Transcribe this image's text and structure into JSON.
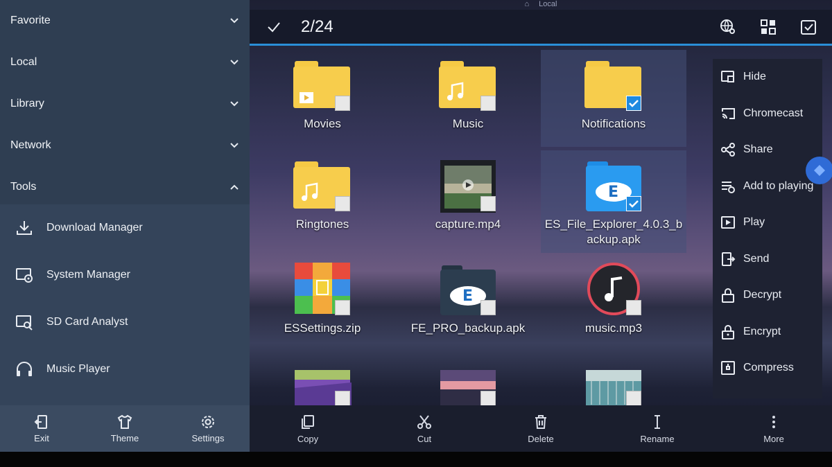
{
  "sidebar": {
    "categories": [
      {
        "label": "Favorite",
        "expanded": false
      },
      {
        "label": "Local",
        "expanded": false
      },
      {
        "label": "Library",
        "expanded": false
      },
      {
        "label": "Network",
        "expanded": false
      },
      {
        "label": "Tools",
        "expanded": true
      }
    ],
    "tools": [
      {
        "label": "Download Manager",
        "icon": "download-icon"
      },
      {
        "label": "System Manager",
        "icon": "system-manager-icon"
      },
      {
        "label": "SD Card Analyst",
        "icon": "sd-card-analyst-icon"
      },
      {
        "label": "Music Player",
        "icon": "headphones-icon"
      }
    ],
    "bottom": [
      {
        "label": "Exit",
        "icon": "exit-icon"
      },
      {
        "label": "Theme",
        "icon": "shirt-icon"
      },
      {
        "label": "Settings",
        "icon": "gear-icon"
      }
    ]
  },
  "statusbar": {
    "text": "Local"
  },
  "topbar": {
    "count": "2/24"
  },
  "files": [
    {
      "label": "Movies",
      "kind": "folder",
      "selected": false
    },
    {
      "label": "Music",
      "kind": "folder",
      "selected": false
    },
    {
      "label": "Notifications",
      "kind": "folder",
      "selected": true
    },
    {
      "label": "Ringtones",
      "kind": "folder",
      "selected": false
    },
    {
      "label": "capture.mp4",
      "kind": "video",
      "selected": false
    },
    {
      "label": "ES_File_Explorer_4.0.3_backup.apk",
      "kind": "apk",
      "selected": true
    },
    {
      "label": "ESSettings.zip",
      "kind": "zip",
      "selected": false
    },
    {
      "label": "FE_PRO_backup.apk",
      "kind": "apk2",
      "selected": false
    },
    {
      "label": "music.mp3",
      "kind": "audio",
      "selected": false
    }
  ],
  "context_menu": [
    {
      "label": "Hide",
      "icon": "hide-icon"
    },
    {
      "label": "Chromecast",
      "icon": "cast-icon"
    },
    {
      "label": "Share",
      "icon": "share-icon"
    },
    {
      "label": "Add to playing",
      "icon": "playlist-add-icon"
    },
    {
      "label": "Play",
      "icon": "play-icon"
    },
    {
      "label": "Send",
      "icon": "send-icon"
    },
    {
      "label": "Decrypt",
      "icon": "unlock-icon"
    },
    {
      "label": "Encrypt",
      "icon": "lock-icon"
    },
    {
      "label": "Compress",
      "icon": "compress-icon"
    }
  ],
  "toolbar": [
    {
      "label": "Copy",
      "icon": "copy-icon"
    },
    {
      "label": "Cut",
      "icon": "scissors-icon"
    },
    {
      "label": "Delete",
      "icon": "trash-icon"
    },
    {
      "label": "Rename",
      "icon": "rename-icon"
    },
    {
      "label": "More",
      "icon": "more-icon"
    }
  ],
  "colors": {
    "accent": "#2a8fd8",
    "folder": "#f7cd4c",
    "sidebar": "#2f3e52"
  }
}
